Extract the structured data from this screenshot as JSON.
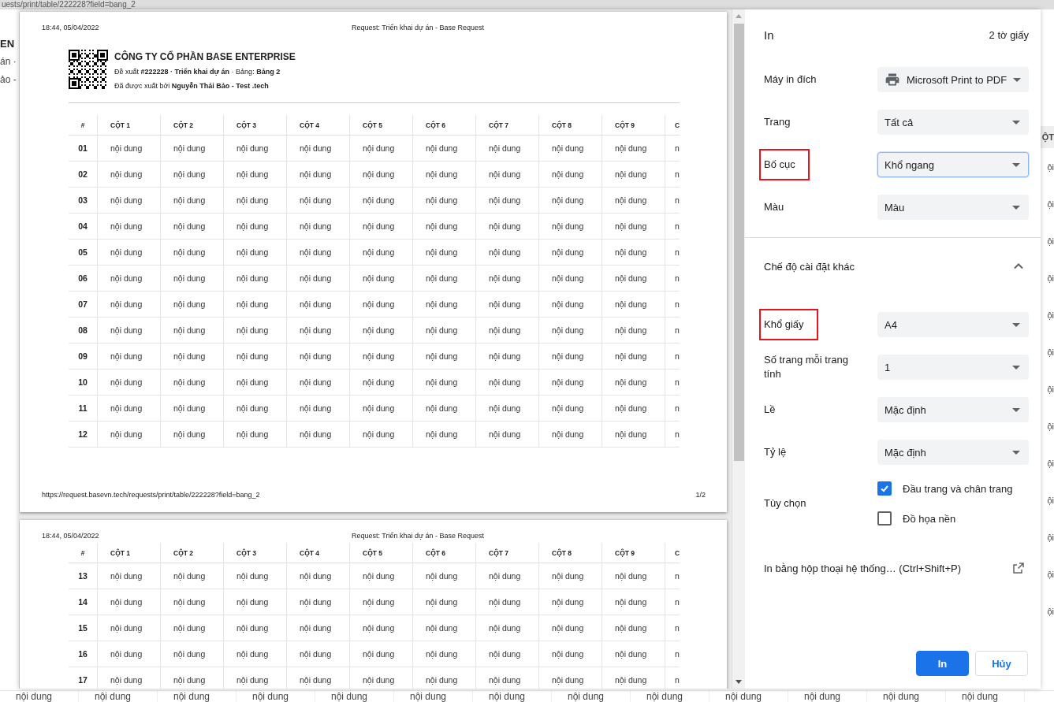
{
  "browser": {
    "url": "uests/print/table/222228?field=bang_2"
  },
  "background_page": {
    "left_fragments": [
      "EN",
      "án ·",
      "ảo -"
    ],
    "right_header_fragment": "ỘT",
    "right_fragments": [
      "ội",
      "ội",
      "ội",
      "ội",
      "ội",
      "ội",
      "ội",
      "ội",
      "ội",
      "ội",
      "ội",
      "ội",
      "ội"
    ],
    "bottom_cells": [
      "nội dung",
      "nội dung",
      "nội dung",
      "nội dung",
      "nội dung",
      "nội dung",
      "nội dung",
      "nội dung",
      "nội dung",
      "nội dung",
      "nội dung",
      "nội dung",
      "nội dung"
    ]
  },
  "print_preview": {
    "pages": [
      {
        "header_time": "18:44, 05/04/2022",
        "header_title": "Request: Triển khai dự án - Base Request",
        "company": {
          "name": "CÔNG TY CỔ PHẦN BASE ENTERPRISE",
          "line_1": "Đề xuất **#222228 · Triển khai dự án** · Bảng: **Bảng 2**",
          "line_2": "Đã được xuất bởi **Nguyễn Thái Bảo - Test .tech**"
        },
        "columns": [
          "#",
          "CỘT 1",
          "CỘT 2",
          "CỘT 3",
          "CỘT 4",
          "CỘT 5",
          "CỘT 6",
          "CỘT 7",
          "CỘT 8",
          "CỘT 9",
          "C"
        ],
        "rows": [
          {
            "cells": [
              "01",
              "nội dung",
              "nội dung",
              "nội dung",
              "nội dung",
              "nội dung",
              "nội dung",
              "nội dung",
              "nội dung",
              "nội dung",
              "n"
            ]
          },
          {
            "cells": [
              "02",
              "nội dung",
              "nội dung",
              "nội dung",
              "nội dung",
              "nội dung",
              "nội dung",
              "nội dung",
              "nội dung",
              "nội dung",
              "n"
            ]
          },
          {
            "cells": [
              "03",
              "nội dung",
              "nội dung",
              "nội dung",
              "nội dung",
              "nội dung",
              "nội dung",
              "nội dung",
              "nội dung",
              "nội dung",
              "n"
            ]
          },
          {
            "cells": [
              "04",
              "nội dung",
              "nội dung",
              "nội dung",
              "nội dung",
              "nội dung",
              "nội dung",
              "nội dung",
              "nội dung",
              "nội dung",
              "n"
            ]
          },
          {
            "cells": [
              "05",
              "nội dung",
              "nội dung",
              "nội dung",
              "nội dung",
              "nội dung",
              "nội dung",
              "nội dung",
              "nội dung",
              "nội dung",
              "n"
            ]
          },
          {
            "cells": [
              "06",
              "nội dung",
              "nội dung",
              "nội dung",
              "nội dung",
              "nội dung",
              "nội dung",
              "nội dung",
              "nội dung",
              "nội dung",
              "n"
            ]
          },
          {
            "cells": [
              "07",
              "nội dung",
              "nội dung",
              "nội dung",
              "nội dung",
              "nội dung",
              "nội dung",
              "nội dung",
              "nội dung",
              "nội dung",
              "n"
            ]
          },
          {
            "cells": [
              "08",
              "nội dung",
              "nội dung",
              "nội dung",
              "nội dung",
              "nội dung",
              "nội dung",
              "nội dung",
              "nội dung",
              "nội dung",
              "n"
            ]
          },
          {
            "cells": [
              "09",
              "nội dung",
              "nội dung",
              "nội dung",
              "nội dung",
              "nội dung",
              "nội dung",
              "nội dung",
              "nội dung",
              "nội dung",
              "n"
            ]
          },
          {
            "cells": [
              "10",
              "nội dung",
              "nội dung",
              "nội dung",
              "nội dung",
              "nội dung",
              "nội dung",
              "nội dung",
              "nội dung",
              "nội dung",
              "n"
            ]
          },
          {
            "cells": [
              "11",
              "nội dung",
              "nội dung",
              "nội dung",
              "nội dung",
              "nội dung",
              "nội dung",
              "nội dung",
              "nội dung",
              "nội dung",
              "n"
            ]
          },
          {
            "cells": [
              "12",
              "nội dung",
              "nội dung",
              "nội dung",
              "nội dung",
              "nội dung",
              "nội dung",
              "nội dung",
              "nội dung",
              "nội dung",
              "n"
            ]
          }
        ],
        "footer_url": "https://request.basevn.tech/requests/print/table/222228?field=bang_2",
        "footer_page": "1/2"
      },
      {
        "header_time": "18:44, 05/04/2022",
        "header_title": "Request: Triển khai dự án - Base Request",
        "columns": [
          "#",
          "CỘT 1",
          "CỘT 2",
          "CỘT 3",
          "CỘT 4",
          "CỘT 5",
          "CỘT 6",
          "CỘT 7",
          "CỘT 8",
          "CỘT 9",
          "C"
        ],
        "rows": [
          {
            "cells": [
              "13",
              "nội dung",
              "nội dung",
              "nội dung",
              "nội dung",
              "nội dung",
              "nội dung",
              "nội dung",
              "nội dung",
              "nội dung",
              "n"
            ]
          },
          {
            "cells": [
              "14",
              "nội dung",
              "nội dung",
              "nội dung",
              "nội dung",
              "nội dung",
              "nội dung",
              "nội dung",
              "nội dung",
              "nội dung",
              "n"
            ]
          },
          {
            "cells": [
              "15",
              "nội dung",
              "nội dung",
              "nội dung",
              "nội dung",
              "nội dung",
              "nội dung",
              "nội dung",
              "nội dung",
              "nội dung",
              "n"
            ]
          },
          {
            "cells": [
              "16",
              "nội dung",
              "nội dung",
              "nội dung",
              "nội dung",
              "nội dung",
              "nội dung",
              "nội dung",
              "nội dung",
              "nội dung",
              "n"
            ]
          },
          {
            "cells": [
              "17",
              "nội dung",
              "nội dung",
              "nội dung",
              "nội dung",
              "nội dung",
              "nội dung",
              "nội dung",
              "nội dung",
              "nội dung",
              "n"
            ]
          }
        ]
      }
    ]
  },
  "settings": {
    "title": "In",
    "sheet_count": "2 tờ giấy",
    "fields": [
      {
        "label": "Máy in đích",
        "value": "Microsoft Print to PDF",
        "kind": "printer",
        "focused": false,
        "highlighted": false
      },
      {
        "label": "Trang",
        "value": "Tất cả",
        "focused": false,
        "highlighted": false
      },
      {
        "label": "Bố cục",
        "value": "Khổ ngang",
        "focused": true,
        "highlighted": true
      },
      {
        "label": "Màu",
        "value": "Màu",
        "focused": false,
        "highlighted": false
      }
    ],
    "more_settings": {
      "label": "Chế độ cài đặt khác",
      "expanded": true,
      "fields": [
        {
          "label": "Khổ giấy",
          "value": "A4",
          "focused": false,
          "highlighted": true
        },
        {
          "label": "Số trang mỗi trang tính",
          "value": "1",
          "focused": false,
          "highlighted": false
        },
        {
          "label": "Lề",
          "value": "Mặc định",
          "focused": false,
          "highlighted": false
        },
        {
          "label": "Tỷ lệ",
          "value": "Mặc định",
          "focused": false,
          "highlighted": false
        }
      ],
      "options_label": "Tùy chọn",
      "options": [
        {
          "label": "Đầu trang và chân trang",
          "checked": true
        },
        {
          "label": "Đồ họa nền",
          "checked": false
        }
      ]
    },
    "system_dialog_link": "In bằng hộp thoại hệ thống… (Ctrl+Shift+P)",
    "buttons": [
      {
        "label": "In",
        "kind": "primary"
      },
      {
        "label": "Hủy",
        "kind": "secondary"
      }
    ]
  }
}
